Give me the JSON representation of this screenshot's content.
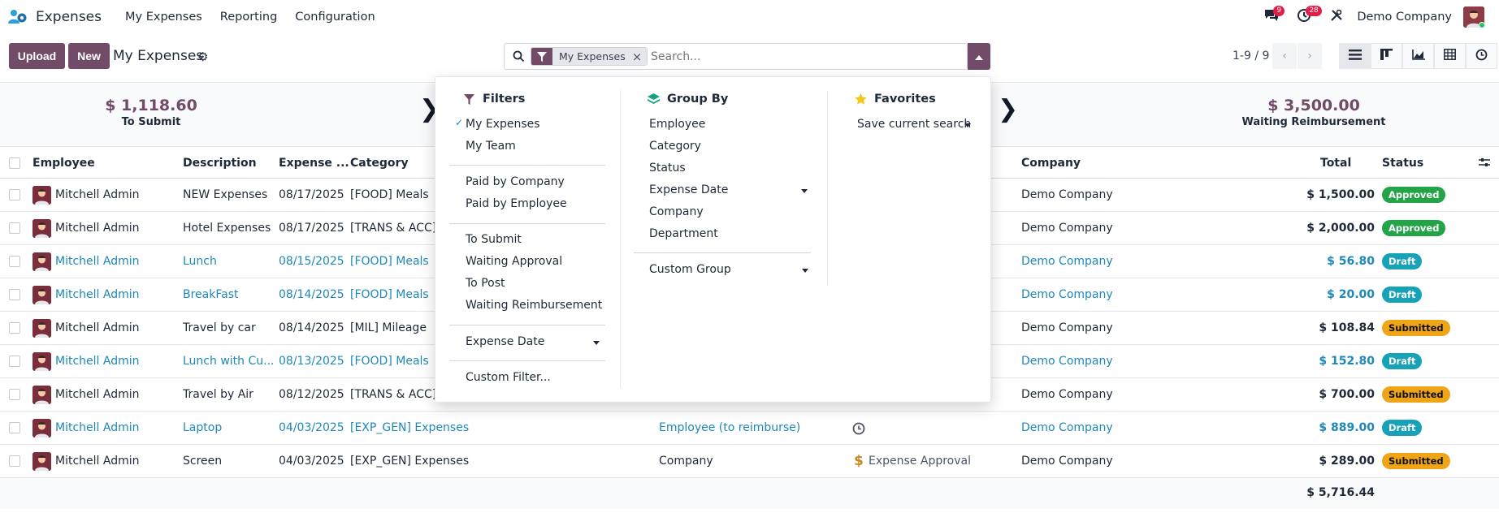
{
  "nav": {
    "app_name": "Expenses",
    "menu": [
      "My Expenses",
      "Reporting",
      "Configuration"
    ],
    "messages_count": "9",
    "activities_count": "28",
    "company": "Demo Company"
  },
  "control": {
    "upload_label": "Upload",
    "new_label": "New",
    "title": "My Expenses",
    "facet_label": "My Expenses",
    "search_placeholder": "Search...",
    "pager": "1-9 / 9"
  },
  "summary": {
    "to_submit_amount": "$ 1,118.60",
    "to_submit_label": "To Submit",
    "waiting_amount": "$ 3,500.00",
    "waiting_label": "Waiting Reimbursement"
  },
  "table": {
    "headers": {
      "employee": "Employee",
      "description": "Description",
      "expense_date": "Expense ...",
      "category": "Category",
      "company": "Company",
      "total": "Total",
      "status": "Status"
    },
    "rows": [
      {
        "employee": "Mitchell Admin",
        "description": "NEW Expenses",
        "date": "08/17/2025",
        "category": "[FOOD] Meals",
        "paid_by": "",
        "activity": "",
        "company": "Demo Company",
        "total": "$ 1,500.00",
        "status": "Approved",
        "status_kind": "approved",
        "draft": false
      },
      {
        "employee": "Mitchell Admin",
        "description": "Hotel Expenses",
        "date": "08/17/2025",
        "category": "[TRANS & ACC] T",
        "paid_by": "",
        "activity": "",
        "company": "Demo Company",
        "total": "$ 2,000.00",
        "status": "Approved",
        "status_kind": "approved",
        "draft": false
      },
      {
        "employee": "Mitchell Admin",
        "description": "Lunch",
        "date": "08/15/2025",
        "category": "[FOOD] Meals",
        "paid_by": "",
        "activity": "",
        "company": "Demo Company",
        "total": "$ 56.80",
        "status": "Draft",
        "status_kind": "draft",
        "draft": true
      },
      {
        "employee": "Mitchell Admin",
        "description": "BreakFast",
        "date": "08/14/2025",
        "category": "[FOOD] Meals",
        "paid_by": "",
        "activity": "",
        "company": "Demo Company",
        "total": "$ 20.00",
        "status": "Draft",
        "status_kind": "draft",
        "draft": true
      },
      {
        "employee": "Mitchell Admin",
        "description": "Travel by car",
        "date": "08/14/2025",
        "category": "[MIL] Mileage",
        "paid_by": "",
        "activity": "",
        "company": "Demo Company",
        "total": "$ 108.84",
        "status": "Submitted",
        "status_kind": "submitted",
        "draft": false
      },
      {
        "employee": "Mitchell Admin",
        "description": "Lunch with Cu...",
        "date": "08/13/2025",
        "category": "[FOOD] Meals",
        "paid_by": "",
        "activity": "",
        "company": "Demo Company",
        "total": "$ 152.80",
        "status": "Draft",
        "status_kind": "draft",
        "draft": true
      },
      {
        "employee": "Mitchell Admin",
        "description": "Travel by Air",
        "date": "08/12/2025",
        "category": "[TRANS & ACC] T",
        "paid_by": "",
        "activity": "",
        "company": "Demo Company",
        "total": "$ 700.00",
        "status": "Submitted",
        "status_kind": "submitted",
        "draft": false
      },
      {
        "employee": "Mitchell Admin",
        "description": "Laptop",
        "date": "04/03/2025",
        "category": "[EXP_GEN] Expenses",
        "paid_by": "Employee (to reimburse)",
        "activity": "clock",
        "company": "Demo Company",
        "total": "$ 889.00",
        "status": "Draft",
        "status_kind": "draft",
        "draft": true
      },
      {
        "employee": "Mitchell Admin",
        "description": "Screen",
        "date": "04/03/2025",
        "category": "[EXP_GEN] Expenses",
        "paid_by": "Company",
        "activity": "Expense Approval",
        "company": "Demo Company",
        "total": "$ 289.00",
        "status": "Submitted",
        "status_kind": "submitted",
        "draft": false
      }
    ],
    "grand_total": "$ 5,716.44"
  },
  "dropdown": {
    "filters_title": "Filters",
    "filters": {
      "my_expenses": "My Expenses",
      "my_team": "My Team",
      "paid_by_company": "Paid by Company",
      "paid_by_employee": "Paid by Employee",
      "to_submit": "To Submit",
      "waiting_approval": "Waiting Approval",
      "to_post": "To Post",
      "waiting_reimbursement": "Waiting Reimbursement",
      "expense_date": "Expense Date",
      "custom_filter": "Custom Filter..."
    },
    "groupby_title": "Group By",
    "groupby": {
      "employee": "Employee",
      "category": "Category",
      "status": "Status",
      "expense_date": "Expense Date",
      "company": "Company",
      "department": "Department",
      "custom_group": "Custom Group"
    },
    "favorites_title": "Favorites",
    "save_search": "Save current search"
  },
  "colors": {
    "brand": "#714b67",
    "link": "#1e88b8",
    "approved": "#22a447",
    "draft": "#17a2b8",
    "submitted": "#f0a418"
  }
}
